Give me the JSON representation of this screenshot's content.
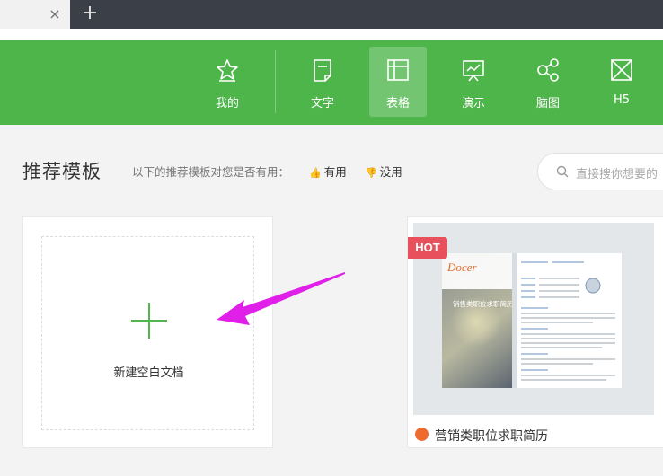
{
  "tabbar": {
    "close_glyph": "×",
    "add_glyph": "+"
  },
  "nav": {
    "items": [
      {
        "label": "我的",
        "icon": "star-icon"
      },
      {
        "label": "文字",
        "icon": "document-icon"
      },
      {
        "label": "表格",
        "icon": "table-icon",
        "active": true
      },
      {
        "label": "演示",
        "icon": "presentation-icon"
      },
      {
        "label": "脑图",
        "icon": "mindmap-icon"
      },
      {
        "label": "H5",
        "icon": "h5-icon"
      }
    ]
  },
  "section": {
    "title": "推荐模板",
    "feedback_prompt": "以下的推荐模板对您是否有用：",
    "useful_label": "有用",
    "useless_label": "没用"
  },
  "search": {
    "placeholder": "直接搜你想要的"
  },
  "blank_card": {
    "label": "新建空白文档"
  },
  "template_card": {
    "badge": "HOT",
    "title": "营销类职位求职简历",
    "preview_caption": "销售类职位求职简历",
    "preview_brand": "Docer"
  },
  "colors": {
    "header_green": "#4eb54b",
    "accent_green": "#54b44f",
    "hot_red": "#e8505b",
    "arrow_magenta": "#e020e8"
  }
}
